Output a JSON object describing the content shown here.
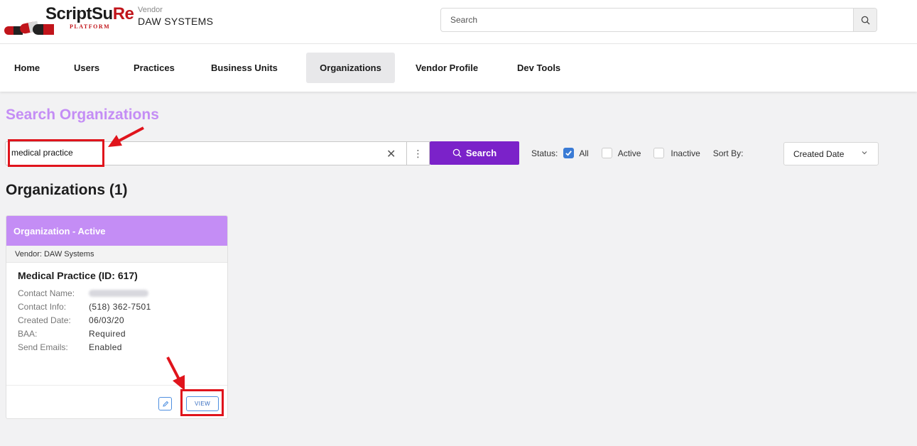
{
  "header": {
    "logo": {
      "word_main": "ScriptSu",
      "word_rx": "Re",
      "sub": "PLATFORM"
    },
    "vendor_label": "Vendor",
    "vendor_name": "DAW SYSTEMS",
    "search_placeholder": "Search",
    "search_icon": "search-icon"
  },
  "nav": {
    "items": [
      {
        "label": "Home",
        "active": false
      },
      {
        "label": "Users",
        "active": false
      },
      {
        "label": "Practices",
        "active": false
      },
      {
        "label": "Business Units",
        "active": false
      },
      {
        "label": "Organizations",
        "active": true
      },
      {
        "label": "Vendor Profile",
        "active": false
      },
      {
        "label": "Dev Tools",
        "active": false
      }
    ]
  },
  "page": {
    "title": "Search Organizations",
    "search_value": "medical practice",
    "clear_icon": "close-icon",
    "menu_icon": "kebab-icon",
    "search_button": "Search",
    "status_label": "Status:",
    "status_options": [
      {
        "label": "All",
        "checked": true
      },
      {
        "label": "Active",
        "checked": false
      },
      {
        "label": "Inactive",
        "checked": false
      }
    ],
    "sort_label": "Sort By:",
    "sort_value": "Created Date",
    "results_heading": "Organizations (1)"
  },
  "card": {
    "header": "Organization - Active",
    "vendor": "Vendor: DAW Systems",
    "title": "Medical Practice (ID: 617)",
    "fields": [
      {
        "key": "Contact Name:",
        "value": ""
      },
      {
        "key": "Contact Info:",
        "value": "(518) 362-7501"
      },
      {
        "key": "Created Date:",
        "value": "06/03/20"
      },
      {
        "key": "BAA:",
        "value": "Required"
      },
      {
        "key": "Send Emails:",
        "value": "Enabled"
      }
    ],
    "edit_icon": "pencil-icon",
    "view_button": "VIEW"
  },
  "colors": {
    "accent_purple": "#c48df5",
    "search_button": "#7b22c9",
    "checkbox_blue": "#3a7bd5",
    "annotation_red": "#e0141c"
  }
}
